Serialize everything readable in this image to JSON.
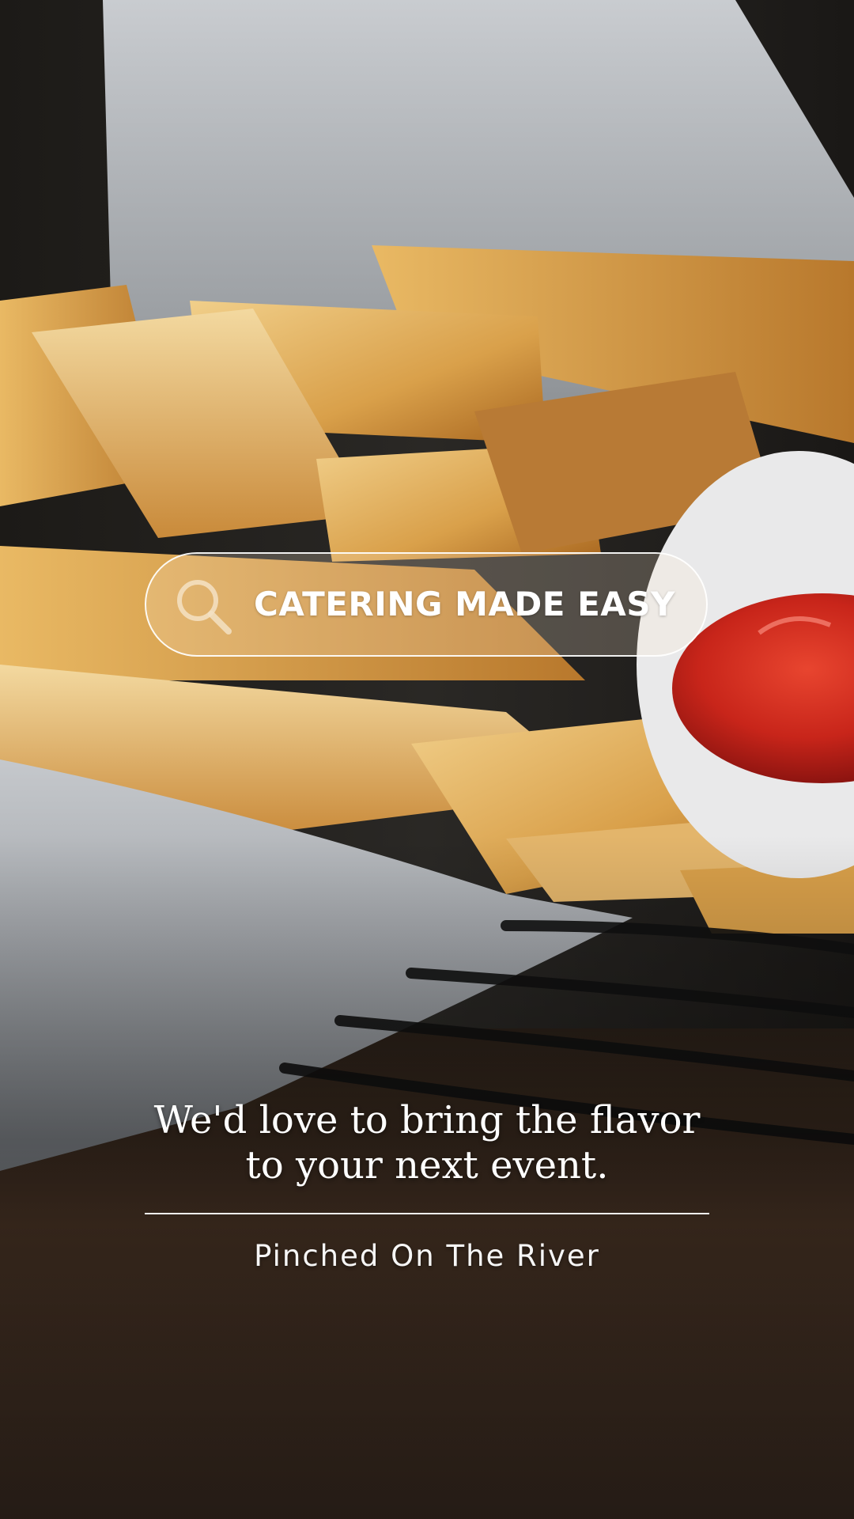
{
  "search_bar": {
    "icon": "search-icon",
    "text": "CATERING MADE EASY"
  },
  "headline": {
    "line1": "We'd love to bring the flavor",
    "line2": "to your next event."
  },
  "tagline": "Pinched On The River",
  "colors": {
    "text": "#ffffff",
    "ketchup": "#c8251a",
    "fries": "#d9a04a"
  }
}
